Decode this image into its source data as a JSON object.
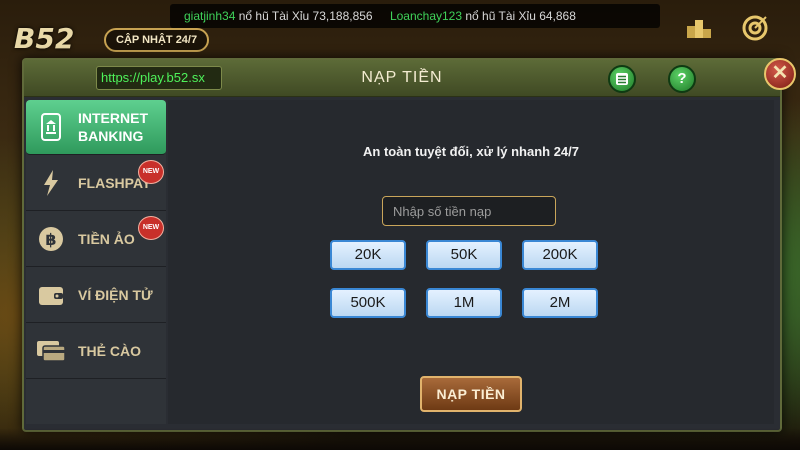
{
  "ticker": {
    "entries": [
      {
        "name": "giatjinh34",
        "text": "nổ hũ Tài Xỉu 73,188,856"
      },
      {
        "name": "Loanchay123",
        "text": "nổ hũ Tài Xỉu 64,868"
      }
    ]
  },
  "logo": {
    "text": "B52"
  },
  "update_tag": "CẬP NHẬT 24/7",
  "top_icons": {
    "leaderboard": "podium-icon",
    "target": "target-icon"
  },
  "modal": {
    "url": "https://play.b52.sx",
    "title": "NẠP TIỀN",
    "history_icon": "list-icon",
    "help_label": "?",
    "close_label": "✕"
  },
  "sidebar": {
    "items": [
      {
        "label_line1": "INTERNET",
        "label_line2": "BANKING",
        "icon": "phone-bank-icon",
        "active": true
      },
      {
        "label_line1": "FLASHPAY",
        "icon": "lightning-icon",
        "badge": "NEW"
      },
      {
        "label_line1": "TIỀN ẢO",
        "icon": "bitcoin-icon",
        "badge": "NEW"
      },
      {
        "label_line1": "VÍ ĐIỆN TỬ",
        "icon": "wallet-icon"
      },
      {
        "label_line1": "THẺ CÀO",
        "icon": "card-icon"
      }
    ]
  },
  "content": {
    "slogan": "An toàn tuyệt đối, xử lý nhanh 24/7",
    "amount_placeholder": "Nhập số tiền nạp",
    "amounts": [
      "20K",
      "50K",
      "200K",
      "500K",
      "1M",
      "2M"
    ],
    "submit_label": "NẠP TIỀN"
  }
}
